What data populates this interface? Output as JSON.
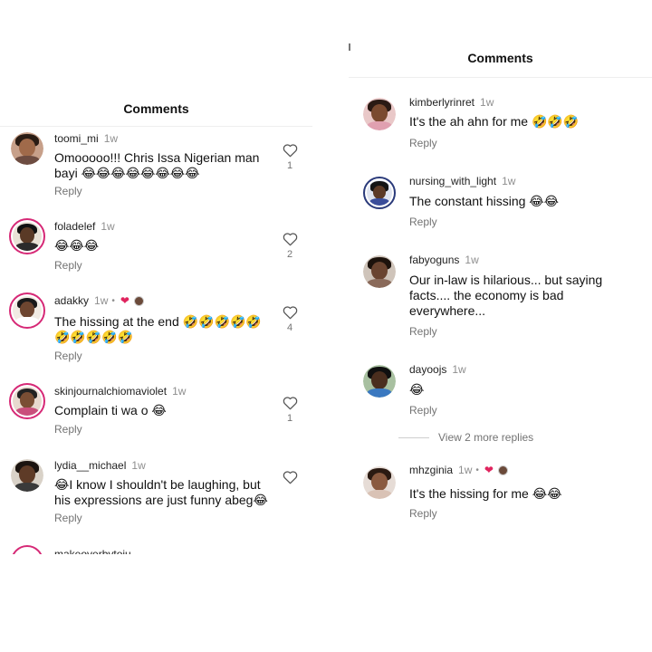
{
  "left": {
    "title": "Comments",
    "comments": [
      {
        "username": "toomi_mi",
        "time": "1w",
        "text": "Omooooo!!! Chris Issa Nigerian man bayi 😂😂😂😂😂😂😂😂",
        "reply": "Reply",
        "likes": "1"
      },
      {
        "username": "foladelef",
        "time": "1w",
        "text": "😂😂😂",
        "reply": "Reply",
        "likes": "2"
      },
      {
        "username": "adakky",
        "time": "1w",
        "dot": "•",
        "text": "The hissing at the end 🤣🤣🤣🤣🤣🤣🤣🤣🤣🤣",
        "reply": "Reply",
        "likes": "4"
      },
      {
        "username": "skinjournalchiomaviolet",
        "time": "1w",
        "text": "Complain ti wa o 😂",
        "reply": "Reply",
        "likes": "1"
      },
      {
        "username": "lydia__michael",
        "time": "1w",
        "text": "😂I know I shouldn't be laughing, but his expressions are just funny abeg😂",
        "reply": "Reply",
        "likes": ""
      }
    ],
    "cut_username": "makeoverbytoju"
  },
  "right": {
    "title": "Comments",
    "comments": [
      {
        "username": "kimberlyrinret",
        "time": "1w",
        "text": "It's the ah ahn for me 🤣🤣🤣",
        "reply": "Reply"
      },
      {
        "username": "nursing_with_light",
        "time": "1w",
        "text": "The constant hissing 😂😂",
        "reply": "Reply"
      },
      {
        "username": "fabyoguns",
        "time": "1w",
        "text": "Our in-law is hilarious... but saying facts.... the economy is bad everywhere...",
        "reply": "Reply"
      },
      {
        "username": "dayoojs",
        "time": "1w",
        "text": "😂",
        "reply": "Reply"
      },
      {
        "username": "mhzginia",
        "time": "1w",
        "dot": "•",
        "text": "It's the hissing for me 😂😂",
        "reply": "Reply"
      }
    ],
    "view_replies": "View 2 more replies"
  },
  "colors": {
    "story_ring": "#d62976",
    "heart_badge": "#e0245e",
    "muted_text": "#737373"
  }
}
